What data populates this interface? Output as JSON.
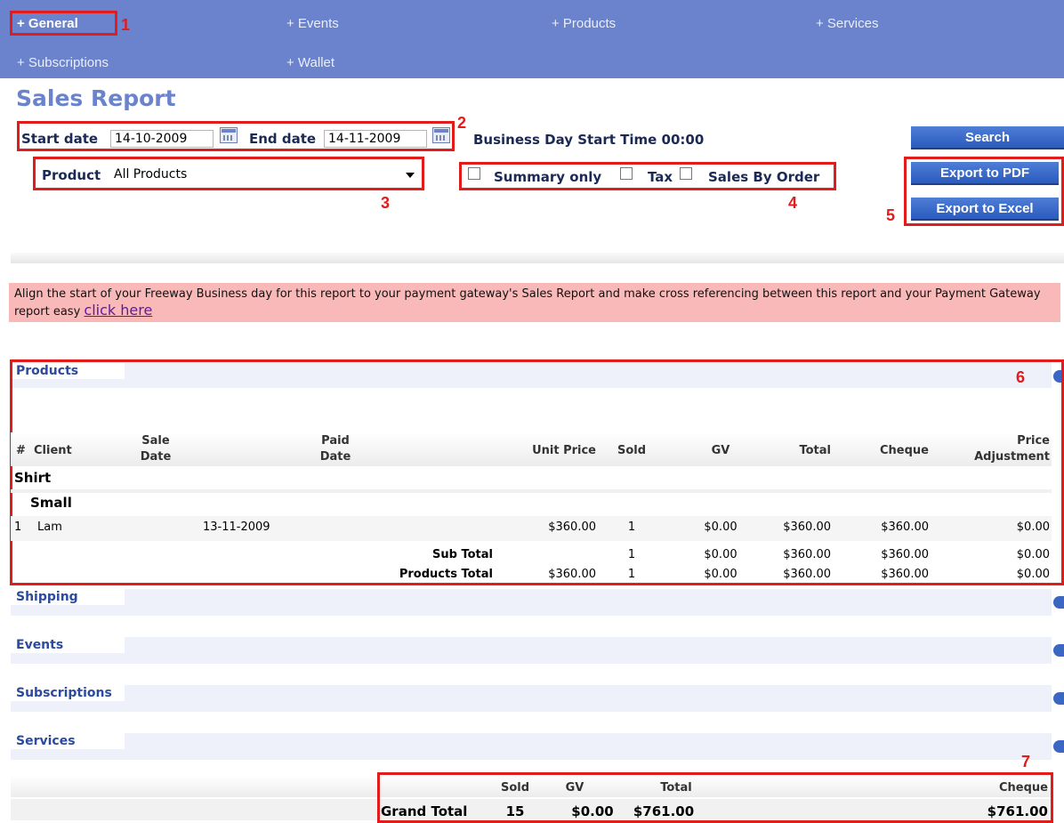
{
  "nav": {
    "items": [
      {
        "label": "+ General",
        "active": true
      },
      {
        "label": "+ Events"
      },
      {
        "label": "+ Products"
      },
      {
        "label": "+ Services"
      },
      {
        "label": "+ Subscriptions"
      },
      {
        "label": "+ Wallet"
      }
    ]
  },
  "annotations": [
    "1",
    "2",
    "3",
    "4",
    "5",
    "6",
    "7"
  ],
  "page": {
    "title": "Sales Report"
  },
  "filters": {
    "start_date_label": "Start date",
    "start_date": "14-10-2009",
    "end_date_label": "End date",
    "end_date": "14-11-2009",
    "business_day": "Business Day Start Time 00:00",
    "product_label": "Product",
    "product_selected": "All Products",
    "summary_only": "Summary only",
    "tax": "Tax",
    "sales_by_order": "Sales By Order"
  },
  "buttons": {
    "search": "Search",
    "export_pdf": "Export to PDF",
    "export_excel": "Export to Excel"
  },
  "notice": {
    "text": "Align the start of your Freeway Business day for this report to your payment gateway's Sales Report and make cross referencing between this report and your Payment Gateway report easy",
    "link": "click here"
  },
  "sections": {
    "products": "Products",
    "shipping": "Shipping",
    "events": "Events",
    "subscriptions": "Subscriptions",
    "services": "Services"
  },
  "products_table": {
    "headers": {
      "num": "#",
      "client": "Client",
      "sale_date_1": "Sale",
      "sale_date_2": "Date",
      "paid_date_1": "Paid",
      "paid_date_2": "Date",
      "unit_price": "Unit Price",
      "sold": "Sold",
      "gv": "GV",
      "total": "Total",
      "cheque": "Cheque",
      "price_adj_1": "Price",
      "price_adj_2": "Adjustment"
    },
    "group": "Shirt",
    "subgroup": "Small",
    "row": {
      "num": "1",
      "client": "Lam",
      "sale_date": "13-11-2009",
      "unit_price": "$360.00",
      "sold": "1",
      "gv": "$0.00",
      "total": "$360.00",
      "cheque": "$360.00",
      "price_adj": "$0.00"
    },
    "subtotal": {
      "label": "Sub Total",
      "sold": "1",
      "gv": "$0.00",
      "total": "$360.00",
      "cheque": "$360.00",
      "price_adj": "$0.00"
    },
    "products_total": {
      "label": "Products Total",
      "unit_price": "$360.00",
      "sold": "1",
      "gv": "$0.00",
      "total": "$360.00",
      "cheque": "$360.00",
      "price_adj": "$0.00"
    }
  },
  "grand_total": {
    "headers": {
      "sold": "Sold",
      "gv": "GV",
      "total": "Total",
      "cheque": "Cheque"
    },
    "label": "Grand Total",
    "sold": "15",
    "gv": "$0.00",
    "total": "$761.00",
    "cheque": "$761.00"
  },
  "colors": {
    "nav_bg": "#6b83cc",
    "accent": "#e21b1b",
    "notice_bg": "#f9b9b9",
    "button": "#2a5bbf"
  }
}
